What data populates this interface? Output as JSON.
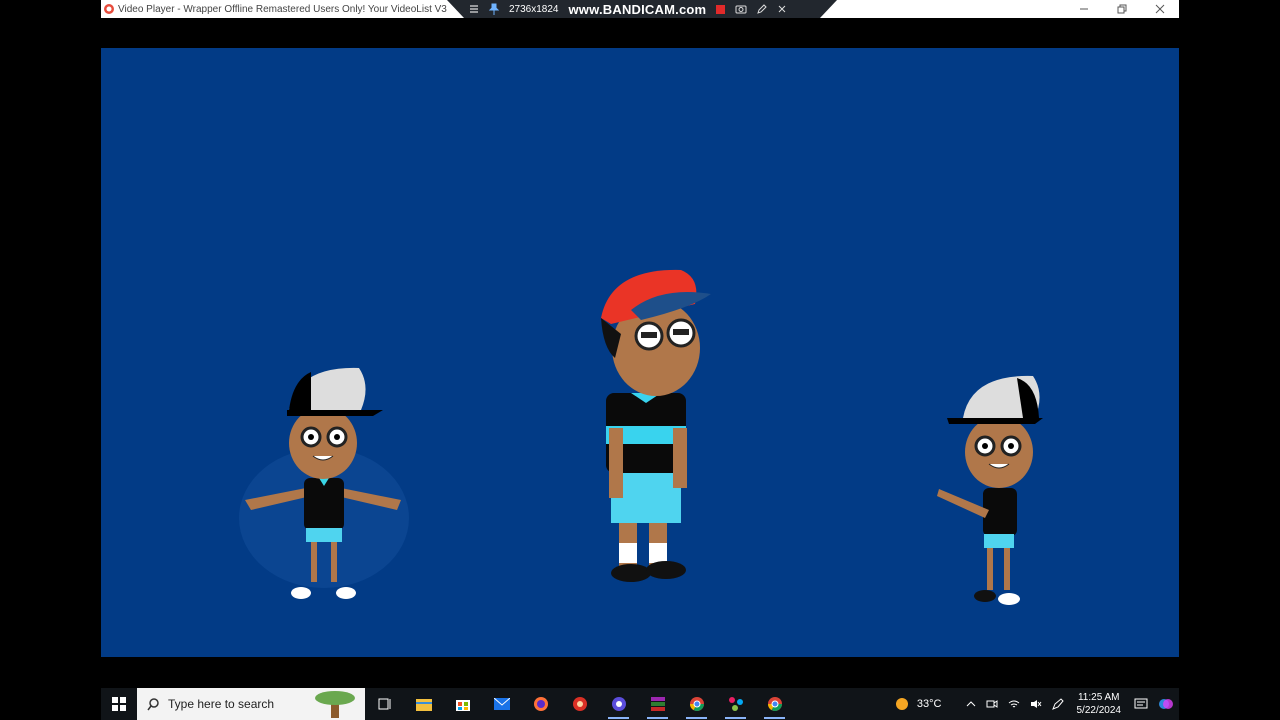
{
  "window": {
    "title": "Video Player - Wrapper Offline Remastered Users Only! Your VideoList V3",
    "controls": [
      "minimize",
      "restore",
      "close"
    ]
  },
  "bandicam": {
    "resolution": "2736x1824",
    "logo": "www.BANDICAM.com"
  },
  "video": {
    "background": "#023b86"
  },
  "taskbar": {
    "search_placeholder": "Type here to search",
    "weather_temp": "33°C",
    "time": "11:25 AM",
    "date": "5/22/2024",
    "apps": [
      "task-view",
      "file-explorer",
      "store",
      "mail",
      "firefox",
      "app-red",
      "app-purple",
      "winrar",
      "chrome",
      "app-network",
      "chrome-2"
    ]
  }
}
